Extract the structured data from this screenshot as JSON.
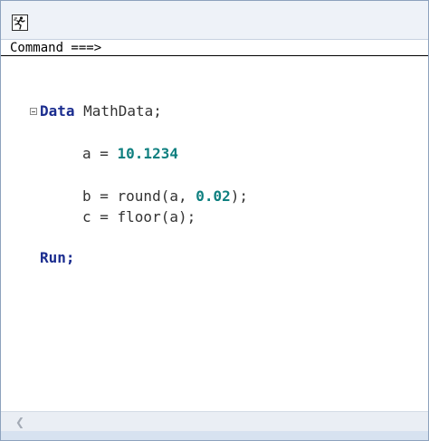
{
  "command_bar": {
    "label": "Command ===>"
  },
  "code": {
    "line1_kw": "Data",
    "line1_rest": " MathData;",
    "line2_pre": "a = ",
    "line2_num": "10.1234",
    "line3_pre": "b = round(a, ",
    "line3_num": "0.02",
    "line3_post": ");",
    "line4": "c = floor(a);",
    "line5_kw": "Run;"
  },
  "icons": {
    "toolbar_run": "run-icon",
    "fold": "collapse-icon",
    "scroll": "chevron-left-icon"
  },
  "colors": {
    "keyword": "#1b2d8f",
    "number": "#0f8080",
    "text": "#333333"
  }
}
